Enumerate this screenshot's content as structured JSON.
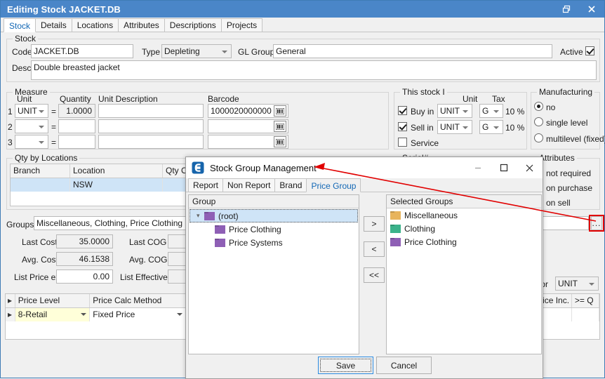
{
  "window": {
    "title": "Editing Stock JACKET.DB",
    "buttons": [
      {
        "name": "restore-button",
        "icon": "restore-icon"
      },
      {
        "name": "close-button",
        "icon": "close-icon"
      }
    ],
    "accent": "#4a86c8"
  },
  "tabs": [
    {
      "label": "Stock",
      "active": true
    },
    {
      "label": "Details",
      "active": false
    },
    {
      "label": "Locations",
      "active": false
    },
    {
      "label": "Attributes",
      "active": false
    },
    {
      "label": "Descriptions",
      "active": false
    },
    {
      "label": "Projects",
      "active": false
    }
  ],
  "stock": {
    "legend": "Stock",
    "code_label": "Code",
    "code_value": "JACKET.DB",
    "type_label": "Type",
    "type_value": "Depleting",
    "gl_group_label": "GL Group",
    "gl_group_value": "General",
    "active_label": "Active",
    "active_checked": true,
    "desc_label": "Desc",
    "desc_value": "Double breasted jacket"
  },
  "measure": {
    "legend": "Measure",
    "headers": {
      "unit": "Unit",
      "quantity": "Quantity",
      "unit_description": "Unit Description",
      "barcode": "Barcode"
    },
    "rows": [
      {
        "num": "1",
        "unit": "UNIT",
        "eq": "=",
        "quantity": "1.0000",
        "unit_description": "",
        "barcode": "1000020000000"
      },
      {
        "num": "2",
        "unit": "",
        "eq": "=",
        "quantity": "",
        "unit_description": "",
        "barcode": ""
      },
      {
        "num": "3",
        "unit": "",
        "eq": "=",
        "quantity": "",
        "unit_description": "",
        "barcode": ""
      }
    ]
  },
  "this_stock": {
    "legend": "This stock I",
    "col_unit": "Unit",
    "col_tax": "Tax",
    "rows": [
      {
        "label": "Buy in",
        "checked": true,
        "unit": "UNIT",
        "tax": "G",
        "pct": "10 %"
      },
      {
        "label": "Sell in",
        "checked": true,
        "unit": "UNIT",
        "tax": "G",
        "pct": "10 %"
      }
    ],
    "service_label": "Service",
    "service_checked": false
  },
  "manufacturing": {
    "legend": "Manufacturing",
    "options": [
      {
        "label": "no",
        "selected": true
      },
      {
        "label": "single level",
        "selected": false
      },
      {
        "label": "multilevel (fixed)",
        "selected": false
      }
    ]
  },
  "serial": {
    "legend": "Serial#"
  },
  "attributes": {
    "legend": "Attributes",
    "options": [
      "not required",
      "on purchase",
      "on sell"
    ]
  },
  "qty_by_locations": {
    "legend": "Qty by Locations",
    "headers": [
      "Branch",
      "Location",
      "Qty On"
    ],
    "rows": [
      {
        "branch": "",
        "location": "NSW",
        "qty_on": "",
        "selected": true
      }
    ]
  },
  "groups": {
    "label": "Groups",
    "value": "Miscellaneous, Clothing, Price Clothing",
    "ellipsis_button": "..."
  },
  "costs": {
    "last_cost_label": "Last Cost",
    "last_cost_value": "35.0000",
    "avg_cost_label": "Avg. Cost",
    "avg_cost_value": "46.1538",
    "list_price_label": "List Price ex",
    "list_price_value": "0.00",
    "last_cog_label": "Last COG",
    "last_cog_value": "",
    "avg_cog_label": "Avg. COG",
    "avg_cog_value": "",
    "list_effective_label": "List Effective",
    "list_effective_value": ""
  },
  "prices_for": {
    "label": "es for",
    "unit": "UNIT"
  },
  "price_grid": {
    "headers": [
      "Price Level",
      "Price Calc Method"
    ],
    "rows": [
      {
        "level": "8-Retail",
        "method": "Fixed Price"
      }
    ],
    "right_headers": [
      "Price Inc.",
      ">= Q"
    ]
  },
  "modal": {
    "title": "Stock Group Management",
    "icon": "app-logo-icon",
    "buttons": [
      {
        "name": "minimize-button",
        "icon": "minimize-icon"
      },
      {
        "name": "maximize-button",
        "icon": "maximize-icon"
      },
      {
        "name": "close-button",
        "icon": "close-icon"
      }
    ],
    "tabs": [
      {
        "label": "Report",
        "active": false
      },
      {
        "label": "Non Report",
        "active": false
      },
      {
        "label": "Brand",
        "active": false
      },
      {
        "label": "Price Group",
        "active": true
      }
    ],
    "group_panel": {
      "header": "Group",
      "tree": [
        {
          "label": "(root)",
          "depth": 0,
          "color": "#8e5fb5",
          "selected": true,
          "expander": true
        },
        {
          "label": "Price Clothing",
          "depth": 1,
          "color": "#8e5fb5",
          "selected": false,
          "expander": false
        },
        {
          "label": "Price Systems",
          "depth": 1,
          "color": "#8e5fb5",
          "selected": false,
          "expander": false
        }
      ]
    },
    "selected_panel": {
      "header": "Selected Groups",
      "items": [
        {
          "label": "Miscellaneous",
          "color": "#e8b45c"
        },
        {
          "label": "Clothing",
          "color": "#3bb28a"
        },
        {
          "label": "Price Clothing",
          "color": "#8e5fb5"
        }
      ]
    },
    "transfer_buttons": [
      {
        "label": ">",
        "name": "add-group-button"
      },
      {
        "label": "<",
        "name": "remove-group-button"
      },
      {
        "label": "<<",
        "name": "remove-all-groups-button"
      }
    ],
    "save_label": "Save",
    "cancel_label": "Cancel"
  },
  "annotation": {
    "color": "#e10000",
    "from": "ellipsis-button",
    "to": "modal-title"
  }
}
